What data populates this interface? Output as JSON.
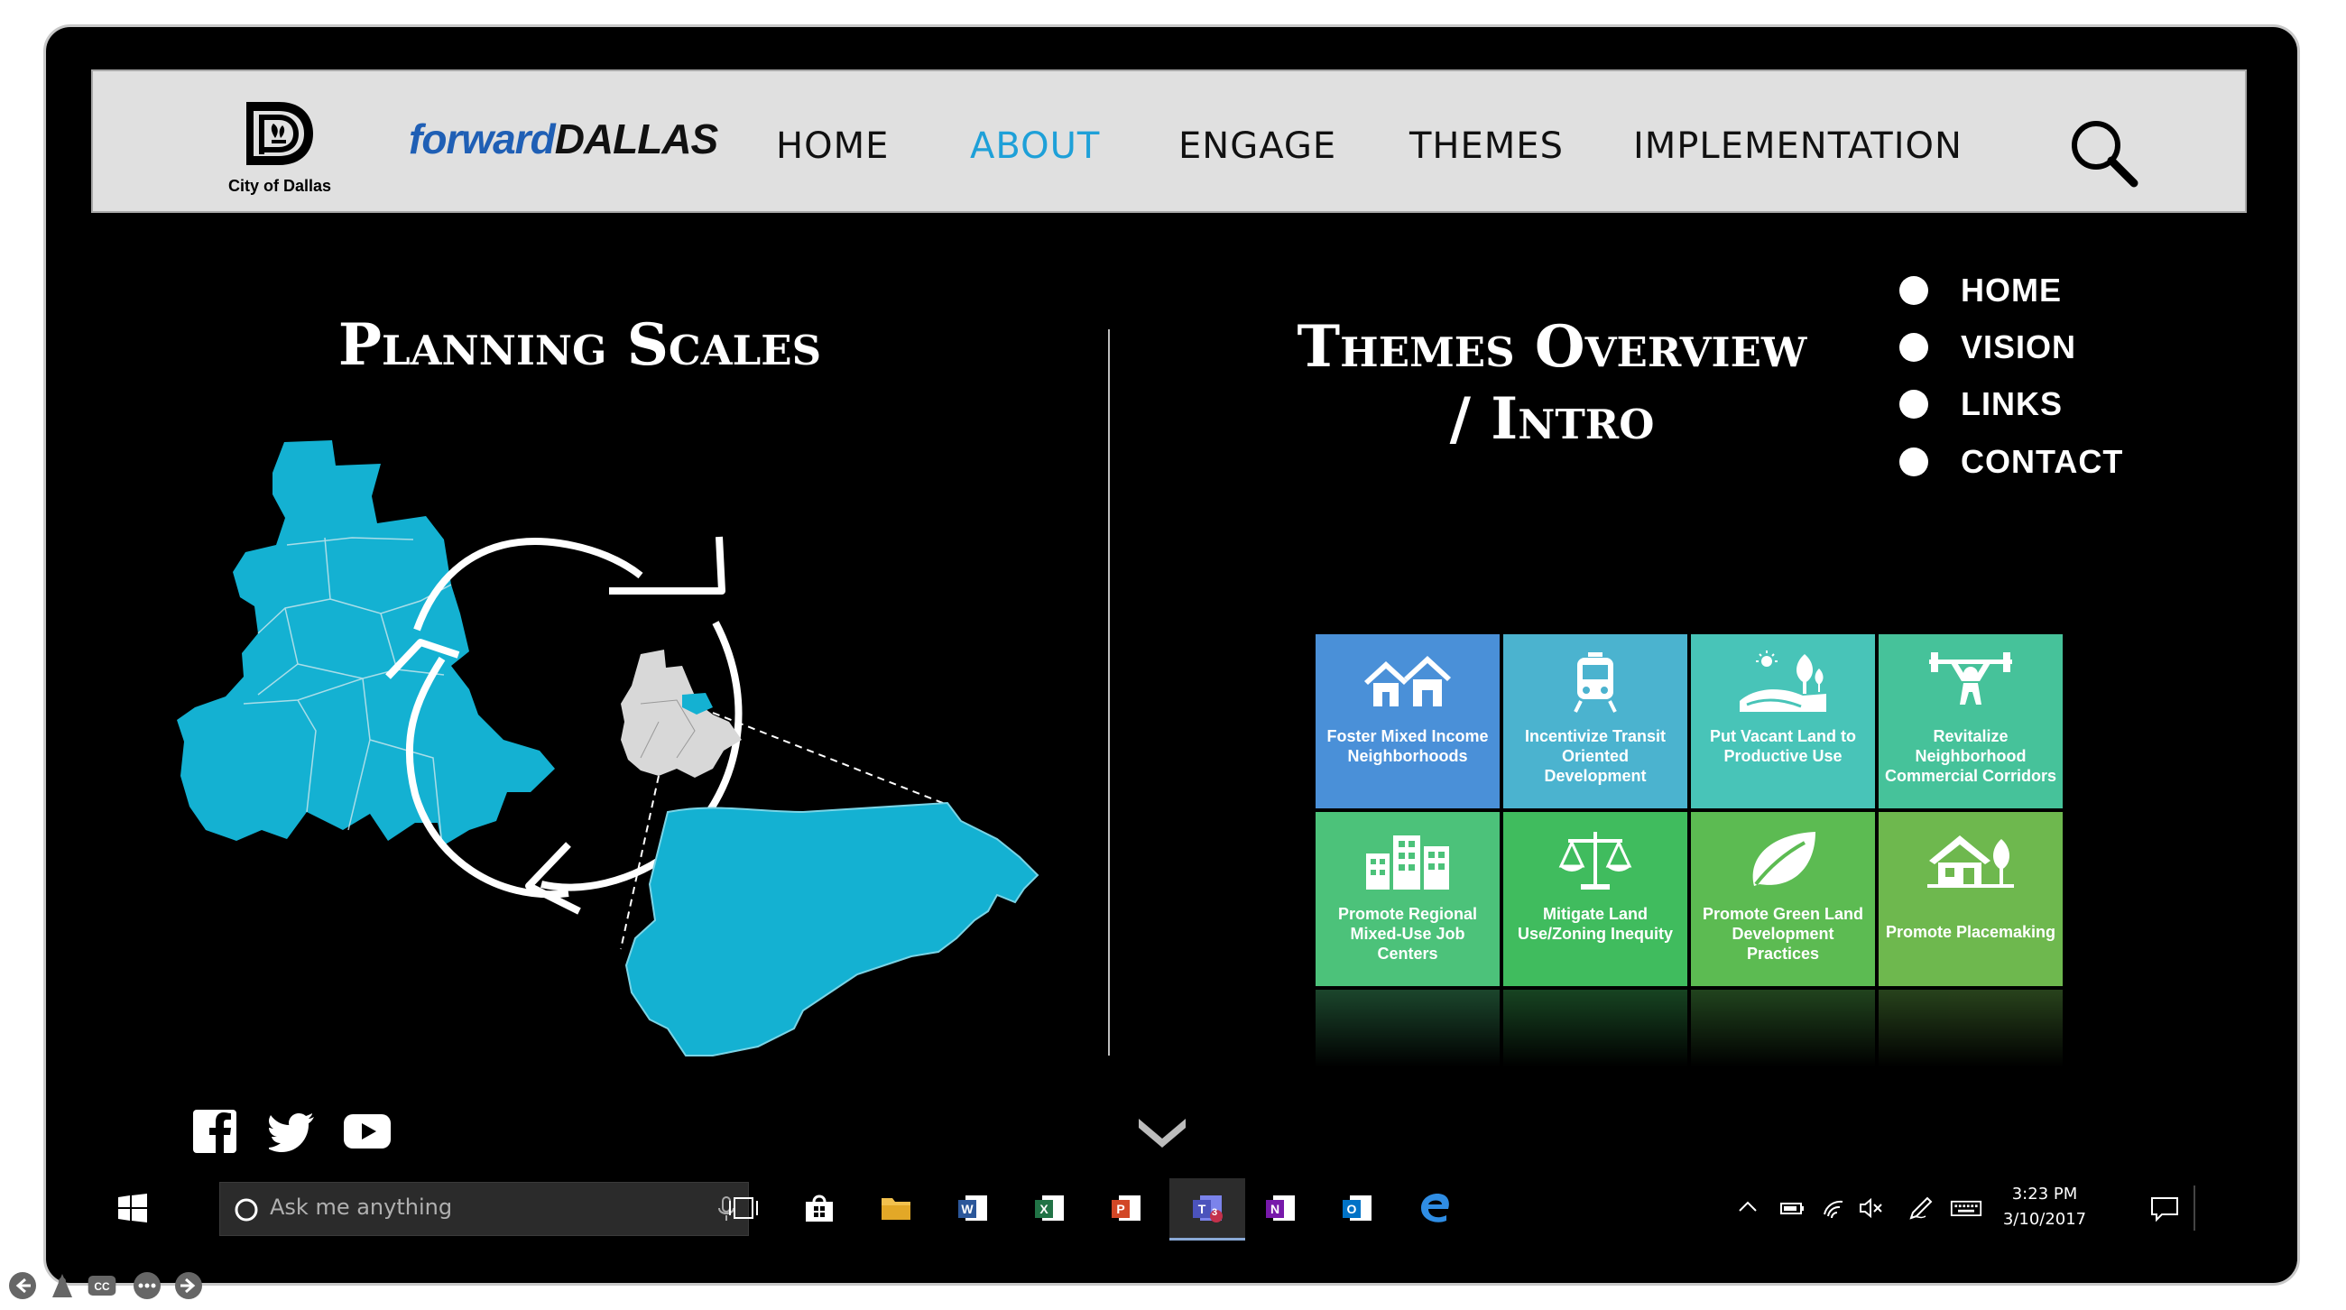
{
  "navbar": {
    "logo_caption": "City of Dallas",
    "brand_left": "forward",
    "brand_right": "DALLAS",
    "links": [
      {
        "label": "HOME",
        "active": false
      },
      {
        "label": "ABOUT",
        "active": true
      },
      {
        "label": "ENGAGE",
        "active": false
      },
      {
        "label": "THEMES",
        "active": false
      },
      {
        "label": "IMPLEMENTATION",
        "active": false
      }
    ],
    "search_icon": "search-icon"
  },
  "left_panel": {
    "title": "Planning Scales"
  },
  "right_panel": {
    "title_line1": "Themes Overview",
    "title_line2": "/ Intro"
  },
  "side_menu": [
    "HOME",
    "VISION",
    "LINKS",
    "CONTACT"
  ],
  "tiles": [
    {
      "label": "Foster Mixed Income Neighborhoods",
      "color": "#4a90d8",
      "icon": "houses-icon"
    },
    {
      "label": "Incentivize Transit Oriented Development",
      "color": "#4bb3cf",
      "icon": "train-icon"
    },
    {
      "label": "Put Vacant Land to Productive Use",
      "color": "#48c4b8",
      "icon": "landscape-icon"
    },
    {
      "label": "Revitalize Neighborhood Commercial Corridors",
      "color": "#46c29a",
      "icon": "weightlifter-icon"
    },
    {
      "label": "Promote Regional Mixed-Use Job Centers",
      "color": "#4cc27a",
      "icon": "buildings-icon"
    },
    {
      "label": "Mitigate Land Use/Zoning Inequity",
      "color": "#40bc5e",
      "icon": "scales-icon"
    },
    {
      "label": "Promote Green Land Development Practices",
      "color": "#5cbb52",
      "icon": "leaf-icon"
    },
    {
      "label": "Promote Placemaking",
      "color": "#6eb84e",
      "icon": "house-tree-icon"
    }
  ],
  "social": [
    "facebook-icon",
    "twitter-icon",
    "youtube-icon"
  ],
  "taskbar": {
    "search_placeholder": "Ask me anything",
    "time": "3:23 PM",
    "date": "3/10/2017",
    "teams_badge": "3"
  },
  "colors": {
    "accent": "#1ea0d8",
    "map_fill": "#14b1d2",
    "frame_bg": "#000000"
  }
}
